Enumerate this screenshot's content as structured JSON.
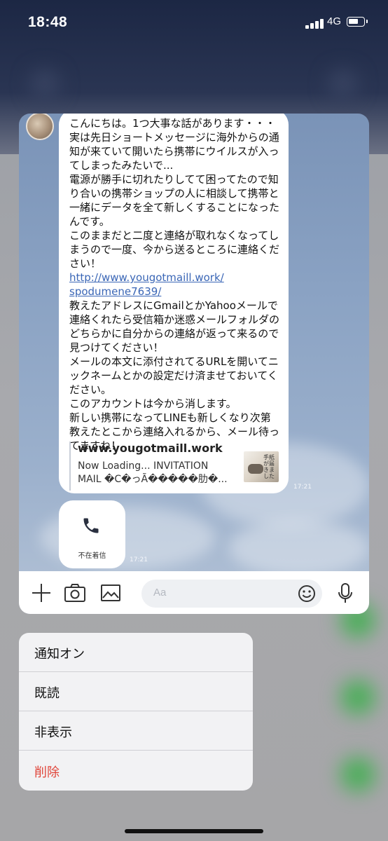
{
  "status_bar": {
    "time": "18:48",
    "network": "4G"
  },
  "chat": {
    "message_text": "こんにちは。1つ大事な話があります・・・実は先日ショートメッセージに海外からの通知が来ていて開いたら携帯にウイルスが入ってしまったみたいで...\n電源が勝手に切れたりしてて困ってたので知り合いの携帯ショップの人に相談して携帯と一緒にデータを全て新しくすることになったんです。\nこのままだと二度と連絡が取れなくなってしまうので一度、今から送るところに連絡ください！",
    "message_link": "http://www.yougotmaill.work/\nspodumene7639/",
    "message_text_2": "教えたアドレスにGmailとかYahooメールで連絡くれたら受信箱か迷惑メールフォルダのどちらかに自分からの連絡が返って来るので見つけてください！\nメールの本文に添付されてるURLを開いてニックネームとかの設定だけ済ませておいてください。\nこのアカウントは今から消します。\n新しい携帯になってLINEも新しくなり次第教えたとこから連絡入れるから、メール待ってますね！",
    "link_preview": {
      "domain": "www.yougotmaill.work",
      "description": "Now Loading... INVITATION\nMAIL �C�っÃ�����肋�...",
      "thumb_text": "手紙が届きました"
    },
    "message_time": "17:21",
    "missed_call": {
      "label": "不在着信",
      "time": "17:21"
    },
    "input": {
      "placeholder": "Aa"
    },
    "icons": [
      "plus-icon",
      "camera-icon",
      "image-icon",
      "emoji-icon",
      "microphone-icon",
      "phone-icon"
    ]
  },
  "menu": {
    "items": [
      {
        "label": "通知オン"
      },
      {
        "label": "既読"
      },
      {
        "label": "非表示"
      },
      {
        "label": "削除",
        "color": "#e0453a"
      }
    ]
  }
}
